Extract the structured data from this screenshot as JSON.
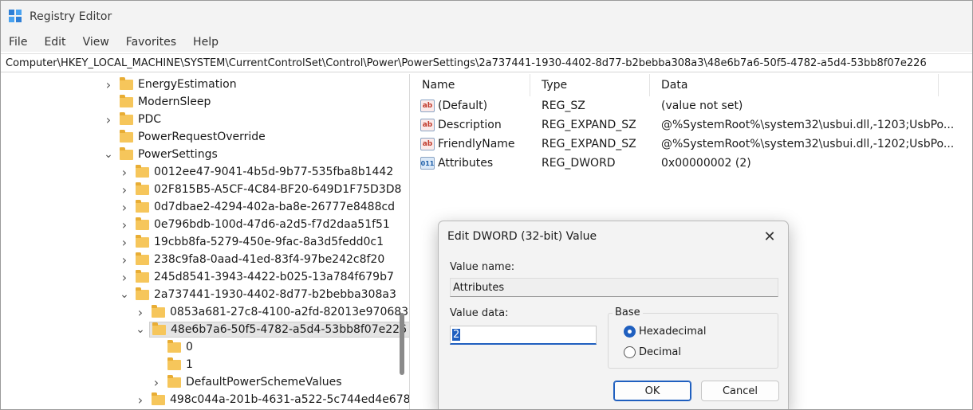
{
  "window": {
    "title": "Registry Editor"
  },
  "menu": [
    "File",
    "Edit",
    "View",
    "Favorites",
    "Help"
  ],
  "address": "Computer\\HKEY_LOCAL_MACHINE\\SYSTEM\\CurrentControlSet\\Control\\Power\\PowerSettings\\2a737441-1930-4402-8d77-b2bebba308a3\\48e6b7a6-50f5-4782-a5d4-53bb8f07e226",
  "tree": [
    {
      "label": "EnergyEstimation",
      "chevron": "right"
    },
    {
      "label": "ModernSleep",
      "chevron": "none"
    },
    {
      "label": "PDC",
      "chevron": "right"
    },
    {
      "label": "PowerRequestOverride",
      "chevron": "none"
    },
    {
      "label": "PowerSettings",
      "chevron": "down"
    },
    {
      "label": "0012ee47-9041-4b5d-9b77-535fba8b1442",
      "chevron": "right"
    },
    {
      "label": "02F815B5-A5CF-4C84-BF20-649D1F75D3D8",
      "chevron": "right"
    },
    {
      "label": "0d7dbae2-4294-402a-ba8e-26777e8488cd",
      "chevron": "right"
    },
    {
      "label": "0e796bdb-100d-47d6-a2d5-f7d2daa51f51",
      "chevron": "right"
    },
    {
      "label": "19cbb8fa-5279-450e-9fac-8a3d5fedd0c1",
      "chevron": "right"
    },
    {
      "label": "238c9fa8-0aad-41ed-83f4-97be242c8f20",
      "chevron": "right"
    },
    {
      "label": "245d8541-3943-4422-b025-13a784f679b7",
      "chevron": "right"
    },
    {
      "label": "2a737441-1930-4402-8d77-b2bebba308a3",
      "chevron": "down"
    },
    {
      "label": "0853a681-27c8-4100-a2fd-82013e970683",
      "chevron": "right"
    },
    {
      "label": "48e6b7a6-50f5-4782-a5d4-53bb8f07e226",
      "chevron": "down",
      "selected": true
    },
    {
      "label": "0",
      "chevron": "none"
    },
    {
      "label": "1",
      "chevron": "none"
    },
    {
      "label": "DefaultPowerSchemeValues",
      "chevron": "right"
    },
    {
      "label": "498c044a-201b-4631-a522-5c744ed4e678",
      "chevron": "right"
    }
  ],
  "columns": {
    "name": "Name",
    "type": "Type",
    "data": "Data"
  },
  "values": [
    {
      "name": "(Default)",
      "type": "REG_SZ",
      "data": "(value not set)",
      "icon": "string-value-icon",
      "glyph": "ab"
    },
    {
      "name": "Description",
      "type": "REG_EXPAND_SZ",
      "data": "@%SystemRoot%\\system32\\usbui.dll,-1203;UsbPo...",
      "icon": "string-value-icon",
      "glyph": "ab"
    },
    {
      "name": "FriendlyName",
      "type": "REG_EXPAND_SZ",
      "data": "@%SystemRoot%\\system32\\usbui.dll,-1202;UsbPo...",
      "icon": "string-value-icon",
      "glyph": "ab"
    },
    {
      "name": "Attributes",
      "type": "REG_DWORD",
      "data": "0x00000002 (2)",
      "icon": "binary-value-icon",
      "glyph": "011"
    }
  ],
  "dialog": {
    "title": "Edit DWORD (32-bit) Value",
    "value_name_label": "Value name:",
    "value_name": "Attributes",
    "value_data_label": "Value data:",
    "value_data": "2",
    "base_label": "Base",
    "hex_label": "Hexadecimal",
    "dec_label": "Decimal",
    "base_selected": "Hexadecimal",
    "ok_label": "OK",
    "cancel_label": "Cancel",
    "close_glyph": "✕"
  },
  "colors": {
    "accent": "#1f5fbf",
    "folder": "#f6c65b",
    "chrome": "#f3f3f3"
  }
}
